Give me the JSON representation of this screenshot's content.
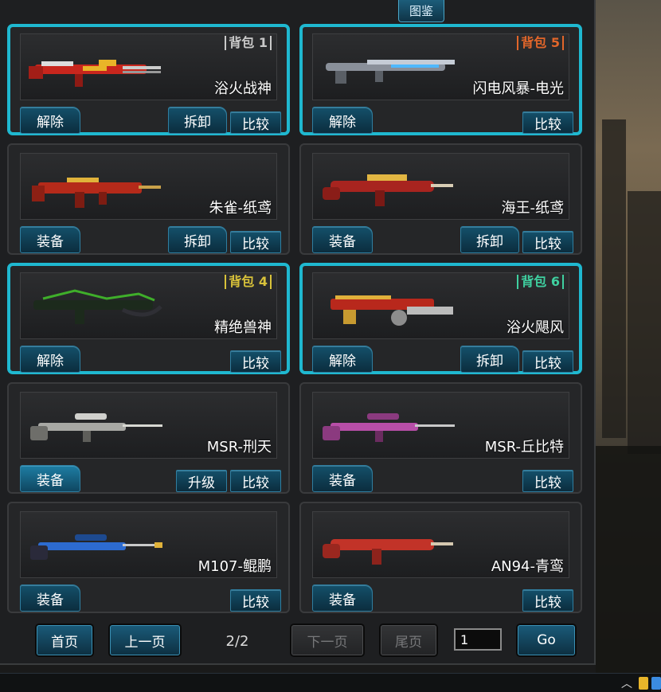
{
  "header": {
    "tab_label": "图鉴"
  },
  "cards": [
    {
      "name": "浴火战神",
      "bag": "背包 1",
      "bag_color": "white",
      "selected": true,
      "buttons": {
        "primary": "解除",
        "dismantle": "拆卸",
        "compare": "比较"
      },
      "gun_color": "#c8261d"
    },
    {
      "name": "闪电风暴-电光",
      "bag": "背包 5",
      "bag_color": "orange",
      "selected": true,
      "buttons": {
        "primary": "解除",
        "compare": "比较"
      },
      "gun_color": "#9aa0aa"
    },
    {
      "name": "朱雀-纸鸢",
      "selected": false,
      "buttons": {
        "primary": "装备",
        "dismantle": "拆卸",
        "compare": "比较"
      },
      "gun_color": "#b52a1a"
    },
    {
      "name": "海王-纸鸢",
      "selected": false,
      "buttons": {
        "primary": "装备",
        "dismantle": "拆卸",
        "compare": "比较"
      },
      "gun_color": "#a8241f"
    },
    {
      "name": "精绝兽神",
      "bag": "背包 4",
      "bag_color": "yellow",
      "selected": true,
      "buttons": {
        "primary": "解除",
        "compare": "比较"
      },
      "gun_color": "#3fae2a"
    },
    {
      "name": "浴火飓风",
      "bag": "背包 6",
      "bag_color": "green",
      "selected": true,
      "buttons": {
        "primary": "解除",
        "dismantle": "拆卸",
        "compare": "比较"
      },
      "gun_color": "#b8281c"
    },
    {
      "name": "MSR-刑天",
      "selected": false,
      "buttons": {
        "primary": "装备",
        "upgrade": "升级",
        "compare": "比较"
      },
      "gun_color": "#b9b9b5"
    },
    {
      "name": "MSR-丘比特",
      "selected": false,
      "buttons": {
        "primary": "装备",
        "compare": "比较"
      },
      "gun_color": "#b84ea8"
    },
    {
      "name": "M107-鲲鹏",
      "selected": false,
      "buttons": {
        "primary": "装备",
        "compare": "比较"
      },
      "gun_color": "#2d6bd0"
    },
    {
      "name": "AN94-青鸾",
      "selected": false,
      "buttons": {
        "primary": "装备",
        "compare": "比较"
      },
      "gun_color": "#c23328"
    }
  ],
  "pager": {
    "first": "首页",
    "prev": "上一页",
    "page_indicator": "2/2",
    "next": "下一页",
    "last": "尾页",
    "page_input": "1",
    "go": "Go"
  }
}
